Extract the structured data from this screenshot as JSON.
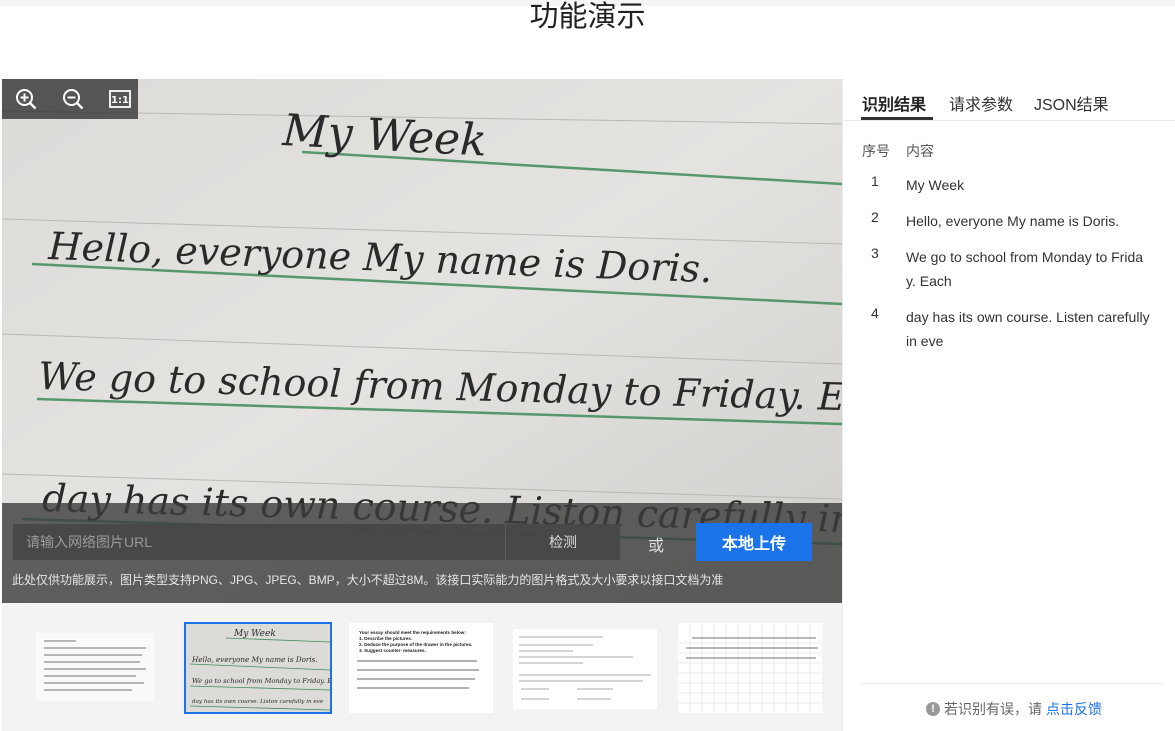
{
  "page": {
    "title": "功能演示"
  },
  "preview": {
    "handwriting_lines": [
      "My Week",
      "Hello, everyone My name is Doris.",
      "We go to school from Monday to Friday. Each",
      "day has its own course. Liston carefully in eve"
    ],
    "zoom_in_label": "放大",
    "zoom_out_label": "缩小",
    "actual_size_label": "1:1",
    "url_placeholder": "请输入网络图片URL",
    "detect_label": "检测",
    "or_label": "或",
    "upload_label": "本地上传",
    "note": "此处仅供功能展示，图片类型支持PNG、JPG、JPEG、BMP，大小不超过8M。该接口实际能力的图片格式及大小要求以接口文档为准"
  },
  "thumbnails": [
    {
      "kind": "chinese-handwriting-note",
      "selected": false
    },
    {
      "kind": "my-week-handwriting",
      "selected": true
    },
    {
      "kind": "essay-requirements",
      "selected": false,
      "lines": [
        "Your essay should meet the requirements below:",
        "1. Describe the pictures.",
        "2. Deduce the purpose of the drawer in the pictures.",
        "3. Suggest counter- measures."
      ]
    },
    {
      "kind": "math-worksheet",
      "selected": false
    },
    {
      "kind": "chinese-grid-paper",
      "selected": false
    }
  ],
  "panel": {
    "tabs": [
      {
        "label": "识别结果",
        "active": true
      },
      {
        "label": "请求参数",
        "active": false
      },
      {
        "label": "JSON结果",
        "active": false
      }
    ],
    "columns": {
      "index": "序号",
      "content": "内容"
    },
    "rows": [
      {
        "index": "1",
        "text": "My Week"
      },
      {
        "index": "2",
        "text": "Hello, everyone My name is Doris."
      },
      {
        "index": "3",
        "text": "We go to school from Monday to Friday. Each"
      },
      {
        "index": "4",
        "text": "day has its own course. Listen carefully in eve"
      }
    ],
    "feedback_prefix": "若识别有误，请",
    "feedback_link": "点击反馈",
    "info_icon_glyph": "!"
  },
  "colors": {
    "accent": "#1a73e8",
    "ruled_line": "#3f8a5a",
    "ink": "#2a2a2a"
  }
}
